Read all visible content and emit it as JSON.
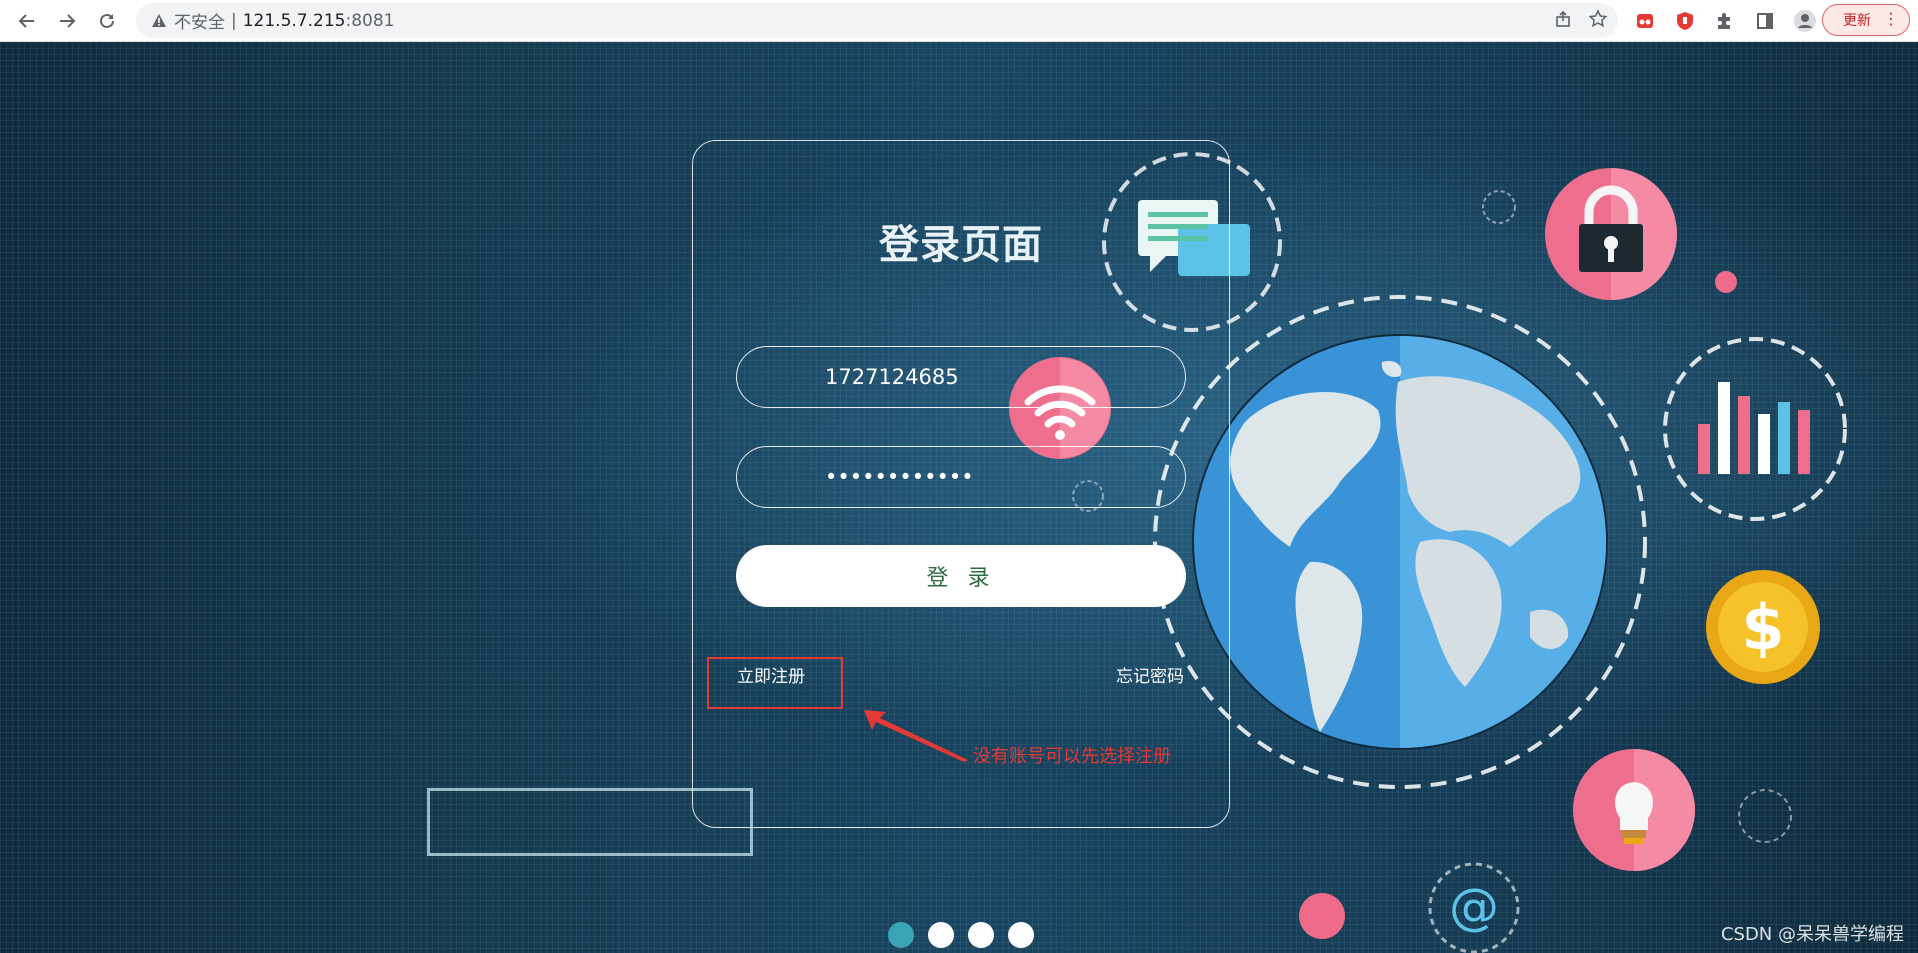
{
  "browser": {
    "security_label": "不安全",
    "separator": "|",
    "url_host": "121.5.7.215",
    "url_port": ":8081",
    "update_label": "更新",
    "menu_glyph": "⋮"
  },
  "login": {
    "title": "登录页面",
    "username_value": "1727124685",
    "password_value": "••••••••••••",
    "login_button": "登 录",
    "register_link": "立即注册",
    "forgot_link": "忘记密码"
  },
  "annotation": {
    "text": "没有账号可以先选择注册",
    "color": "#e53935"
  },
  "carousel": {
    "count": 4,
    "active_index": 0
  },
  "watermark": "CSDN @呆呆兽学编程",
  "colors": {
    "accent_button_text": "#2e6b3e",
    "annotation": "#e53935",
    "background": "#0f2c3e"
  },
  "icons": [
    "back-icon",
    "forward-icon",
    "reload-icon",
    "warning-icon",
    "share-icon",
    "star-icon",
    "extension-icon",
    "sidebar-icon",
    "profile-icon",
    "chat-icon",
    "wifi-icon",
    "lock-icon",
    "bar-chart-icon",
    "dollar-icon",
    "lightbulb-icon",
    "at-sign-icon",
    "globe-icon"
  ]
}
